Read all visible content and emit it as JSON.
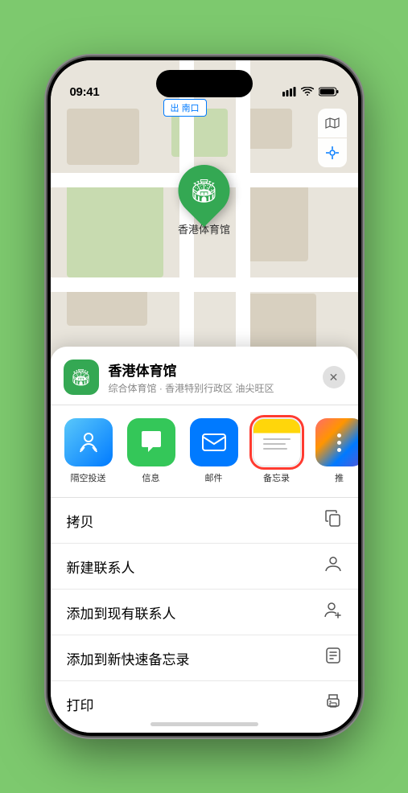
{
  "statusBar": {
    "time": "09:41",
    "locationArrow": "▲",
    "signal": "●●●",
    "wifi": "wifi",
    "battery": "battery"
  },
  "mapLabel": {
    "text": "南口",
    "prefix": "出"
  },
  "mapControls": {
    "mapIcon": "🗺",
    "locationIcon": "⌖"
  },
  "pin": {
    "label": "香港体育馆",
    "icon": "🏟"
  },
  "sheet": {
    "title": "香港体育馆",
    "subtitle": "综合体育馆 · 香港特别行政区 油尖旺区",
    "closeIcon": "✕"
  },
  "shareApps": [
    {
      "id": "airdrop",
      "label": "隔空投送",
      "type": "airdrop"
    },
    {
      "id": "messages",
      "label": "信息",
      "type": "messages"
    },
    {
      "id": "mail",
      "label": "邮件",
      "type": "mail"
    },
    {
      "id": "notes",
      "label": "备忘录",
      "type": "notes",
      "selected": true
    },
    {
      "id": "more",
      "label": "推",
      "type": "more"
    }
  ],
  "actions": [
    {
      "id": "copy",
      "label": "拷贝",
      "icon": "copy"
    },
    {
      "id": "new-contact",
      "label": "新建联系人",
      "icon": "person"
    },
    {
      "id": "add-to-contact",
      "label": "添加到现有联系人",
      "icon": "person-add"
    },
    {
      "id": "add-to-notes",
      "label": "添加到新快速备忘录",
      "icon": "note"
    },
    {
      "id": "print",
      "label": "打印",
      "icon": "print"
    }
  ],
  "colors": {
    "green": "#34a853",
    "blue": "#007aff",
    "red": "#ff3b30"
  }
}
